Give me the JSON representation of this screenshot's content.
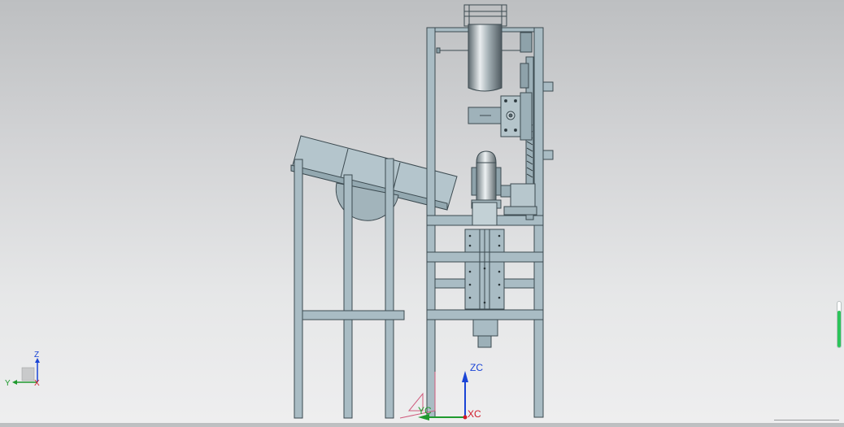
{
  "viewport": {
    "background_top": "#bdbfc1",
    "background_bottom": "#eeeeef",
    "model_fill": "#a9bcc4",
    "model_stroke": "#3c4a50"
  },
  "triad": {
    "x_label": "XC",
    "y_label": "YC",
    "z_label": "ZC",
    "x_color": "#d11a2a",
    "y_color": "#1f9a2e",
    "z_color": "#1a44d6"
  },
  "mini_triad": {
    "x_label": "X",
    "y_label": "Y",
    "z_label": "Z"
  },
  "scroll_indicator": {
    "level_fraction": 0.8,
    "color": "#2cc45a"
  }
}
